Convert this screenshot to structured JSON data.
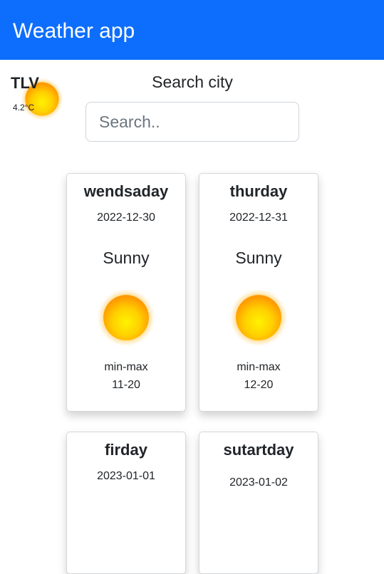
{
  "navbar": {
    "title": "Weather app"
  },
  "current": {
    "city": "TLV",
    "temperature": "4.2°C",
    "icon": "sun-icon"
  },
  "search": {
    "label": "Search city",
    "placeholder": "Search.."
  },
  "forecast": [
    {
      "day": "wendsaday",
      "date": "2022-12-30",
      "description": "Sunny",
      "icon": "sun-icon",
      "minmax_label": "min-max",
      "minmax": "11-20"
    },
    {
      "day": "thurday",
      "date": "2022-12-31",
      "description": "Sunny",
      "icon": "sun-icon",
      "minmax_label": "min-max",
      "minmax": "12-20"
    },
    {
      "day": "firday",
      "date": "2023-01-01",
      "description": "",
      "icon": "",
      "minmax_label": "",
      "minmax": ""
    },
    {
      "day": "sutartday",
      "date": "2023-01-02",
      "description": "",
      "icon": "",
      "minmax_label": "",
      "minmax": ""
    }
  ],
  "colors": {
    "navbar": "#0d6efd",
    "sun_core": "#ffd400",
    "sun_glow": "#ff9800"
  }
}
